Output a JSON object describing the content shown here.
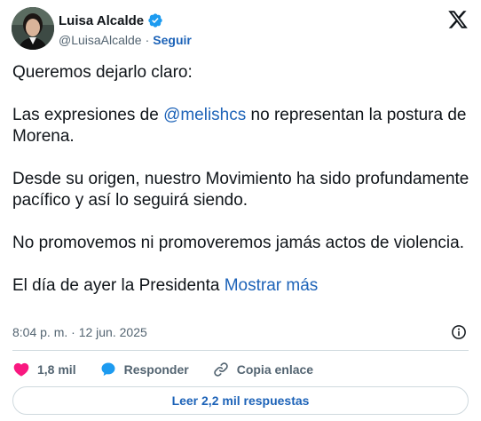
{
  "author": {
    "name": "Luisa Alcalde",
    "handle": "@LuisaAlcalde",
    "separator": "·",
    "follow_label": "Seguir"
  },
  "tweet": {
    "p1": "Queremos dejarlo claro:",
    "p2_before": "Las expresiones de ",
    "p2_mention": "@melishcs",
    "p2_after": " no representan la postura de Morena.",
    "p3": "Desde su origen, nuestro Movimiento ha sido profundamente pacífico y así lo seguirá siendo.",
    "p4": "No promovemos ni promoveremos jamás actos de violencia.",
    "p5": "El día de ayer la Presidenta ",
    "show_more": "Mostrar más"
  },
  "meta": {
    "timestamp": "8:04 p. m. · 12 jun. 2025"
  },
  "actions": {
    "likes": "1,8 mil",
    "reply_label": "Responder",
    "copy_link_label": "Copia enlace"
  },
  "read_replies_label": "Leer 2,2 mil respuestas",
  "colors": {
    "accent": "#1d63b8",
    "verified": "#1d9bf0",
    "like": "#f91880",
    "muted": "#536471"
  },
  "icons": {
    "verified": "verified-badge-icon",
    "logo": "x-logo-icon",
    "info": "info-icon",
    "like": "heart-icon",
    "reply": "speech-bubble-icon",
    "link": "link-icon"
  }
}
